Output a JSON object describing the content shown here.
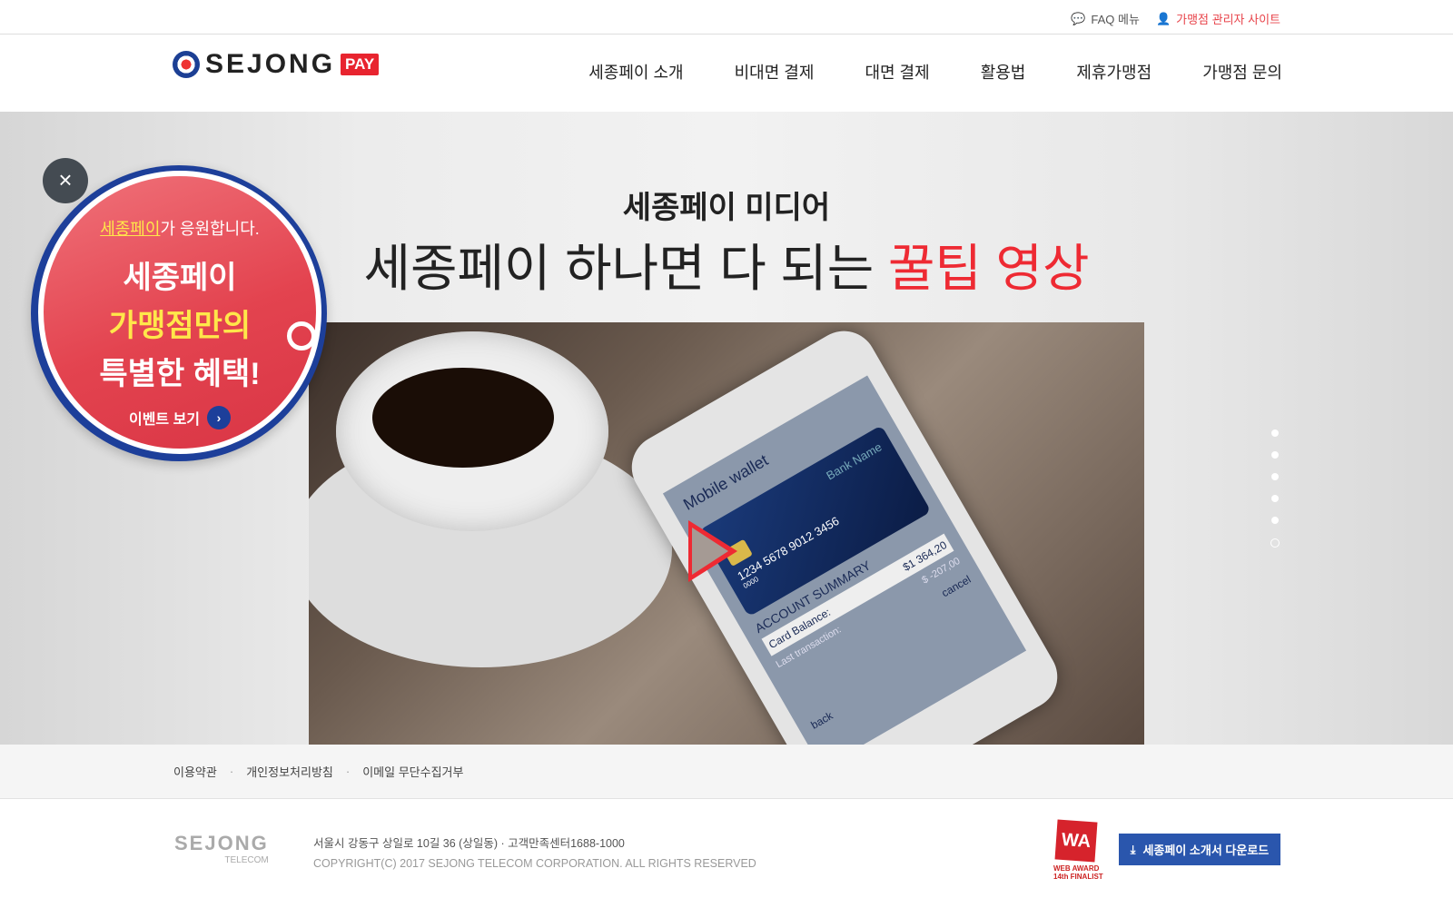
{
  "topbar": {
    "faq": "FAQ 메뉴",
    "admin": "가맹점 관리자 사이트"
  },
  "header": {
    "logo_text": "SEJONG",
    "logo_badge": "PAY",
    "nav": [
      "세종페이 소개",
      "비대면 결제",
      "대면 결제",
      "활용법",
      "제휴가맹점",
      "가맹점 문의"
    ]
  },
  "hero": {
    "subtitle": "세종페이 미디어",
    "title_main": "세종페이 하나면 다 되는 ",
    "title_highlight": "꿀팁 영상",
    "video": {
      "wallet_title": "Mobile wallet",
      "bank_name": "Bank Name",
      "card_number": "1234 5678 9012 3456",
      "card_small": "0000",
      "summary": "ACCOUNT SUMMARY",
      "balance_label": "Card Balance:",
      "balance": "$1 364,20",
      "last_label": "Last transaction:",
      "last": "$ -207,00",
      "cancel": "cancel",
      "back": "back"
    },
    "slides": 6,
    "active_slide": 6
  },
  "popup": {
    "brand": "세종페이",
    "cheer_rest": "가 응원합니다.",
    "line1": "세종페이",
    "line2": "가맹점만의",
    "line3": "특별한 혜택!",
    "event": "이벤트 보기",
    "close": "×"
  },
  "footer_links": [
    "이용약관",
    "개인정보처리방침",
    "이메일 무단수집거부"
  ],
  "footer": {
    "logo_text": "SEJONG",
    "logo_sub": "TELECOM",
    "address": "서울시 강동구 상일로 10길 36 (상일동)  ·  고객만족센터1688-1000",
    "copyright": "COPYRIGHT(C) 2017 SEJONG TELECOM CORPORATION. ALL RIGHTS RESERVED",
    "award_logo": "WA",
    "award_caption": "WEB AWARD 14th FINALIST",
    "download": "세종페이 소개서 다운로드"
  },
  "colors": {
    "accent": "#ee2a33",
    "blue": "#2a56ad"
  }
}
